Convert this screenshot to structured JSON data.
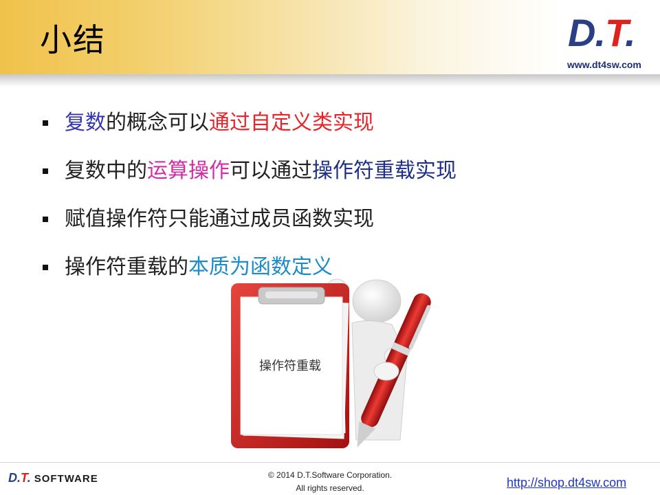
{
  "header": {
    "title": "小结",
    "logo": {
      "d": "D",
      "dot1": ".",
      "t": "T",
      "dot2": "."
    },
    "site": "www.dt4sw.com"
  },
  "bullets": [
    {
      "parts": [
        {
          "text": "复数",
          "color": "#3535b0"
        },
        {
          "text": "的概念可以",
          "color": "#222222"
        },
        {
          "text": "通过自定义类实现",
          "color": "#e3262a"
        }
      ]
    },
    {
      "parts": [
        {
          "text": "复数中的",
          "color": "#222222"
        },
        {
          "text": "运算操作",
          "color": "#d62ba8"
        },
        {
          "text": "可以通过",
          "color": "#222222"
        },
        {
          "text": "操作符重载实现",
          "color": "#1f2f88"
        }
      ]
    },
    {
      "parts": [
        {
          "text": "赋值操作符只能通过成员函数实现",
          "color": "#222222"
        }
      ]
    },
    {
      "parts": [
        {
          "text": "操作符重载的",
          "color": "#222222"
        },
        {
          "text": "本质为函数定义",
          "color": "#1f8bc6"
        }
      ]
    }
  ],
  "illustration": {
    "clipboard_text": "操作符重载"
  },
  "footer": {
    "logo": {
      "d": "D",
      "dot1": ".",
      "t": "T",
      "dot2": ".",
      "software": "SOFTWARE"
    },
    "copyright": "© 2014 D.T.Software Corporation.",
    "rights": "All rights reserved.",
    "shop_link": "http://shop.dt4sw.com"
  }
}
